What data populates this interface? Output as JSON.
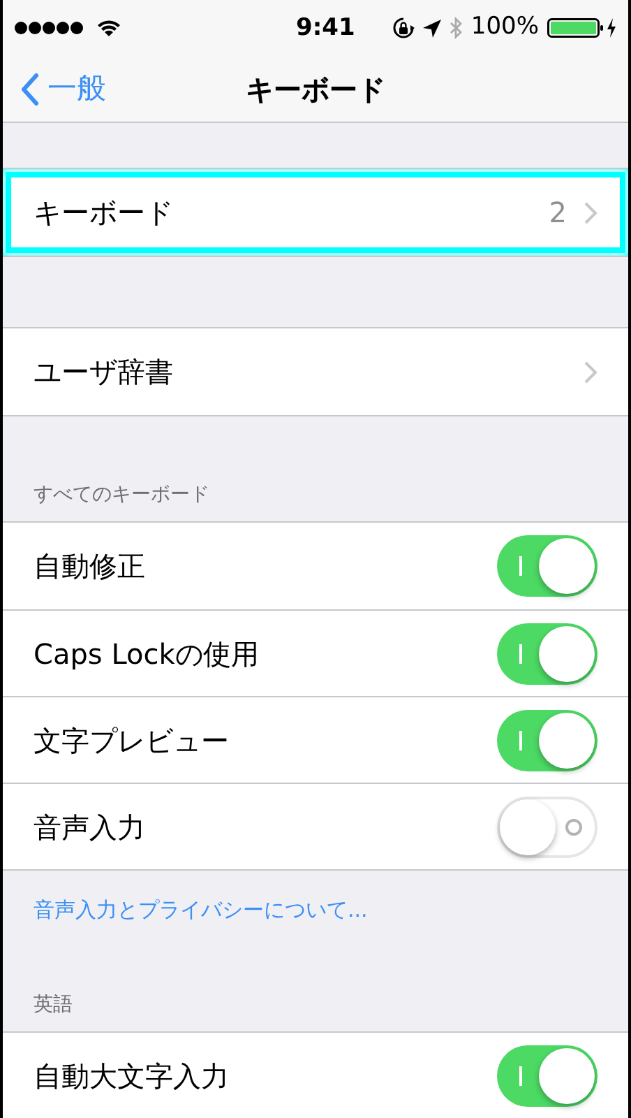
{
  "status_bar": {
    "time": "9:41",
    "battery": "100%"
  },
  "nav": {
    "back": "一般",
    "title": "キーボード"
  },
  "sections": [
    {
      "rows": [
        {
          "kind": "disclosure",
          "label": "キーボード",
          "value": "2",
          "highlighted": true
        }
      ]
    },
    {
      "rows": [
        {
          "kind": "disclosure",
          "label": "ユーザ辞書",
          "highlighted": false
        }
      ]
    },
    {
      "header": "すべてのキーボード",
      "rows": [
        {
          "kind": "switch",
          "label": "自動修正",
          "on": true
        },
        {
          "kind": "switch",
          "label": "Caps Lockの使用",
          "on": true
        },
        {
          "kind": "switch",
          "label": "文字プレビュー",
          "on": true
        },
        {
          "kind": "switch",
          "label": "音声入力",
          "on": false
        }
      ],
      "footer_link": "音声入力とプライバシーについて..."
    },
    {
      "header": "英語",
      "rows": [
        {
          "kind": "switch",
          "label": "自動大文字入力",
          "on": true
        }
      ]
    }
  ]
}
